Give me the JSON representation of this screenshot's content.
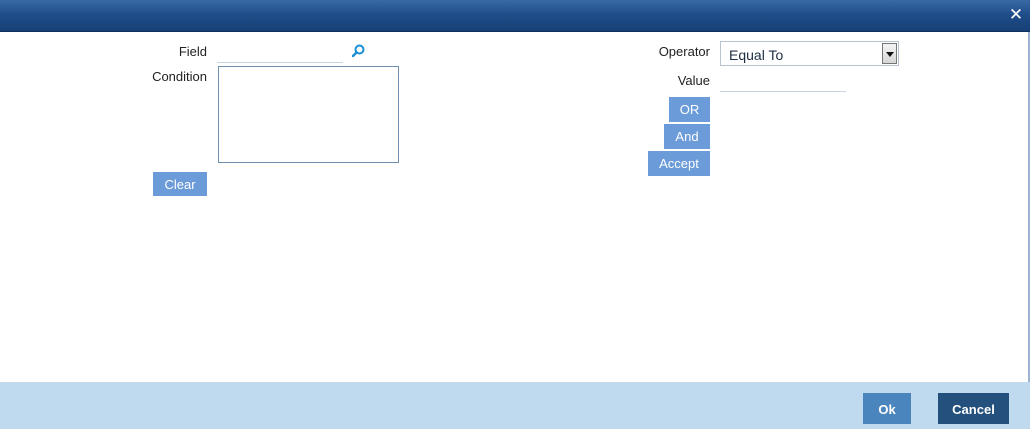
{
  "window": {
    "title": "",
    "close_glyph": "✕"
  },
  "form": {
    "field_label": "Field",
    "field_value": "",
    "condition_label": "Condition",
    "condition_value": "",
    "operator_label": "Operator",
    "operator_selected": "Equal To",
    "value_label": "Value",
    "value_value": ""
  },
  "buttons": {
    "clear": "Clear",
    "or": "OR",
    "and": "And",
    "accept": "Accept"
  },
  "footer": {
    "ok": "Ok",
    "cancel": "Cancel"
  },
  "colors": {
    "titlebar": "#1f4e8a",
    "button": "#6b9bd8",
    "footer": "#bfd9ef",
    "ok_button": "#4a86bd",
    "cancel_button": "#24507e"
  },
  "icons": {
    "close": "close-icon",
    "search": "search-icon",
    "dropdown": "chevron-down-icon"
  }
}
